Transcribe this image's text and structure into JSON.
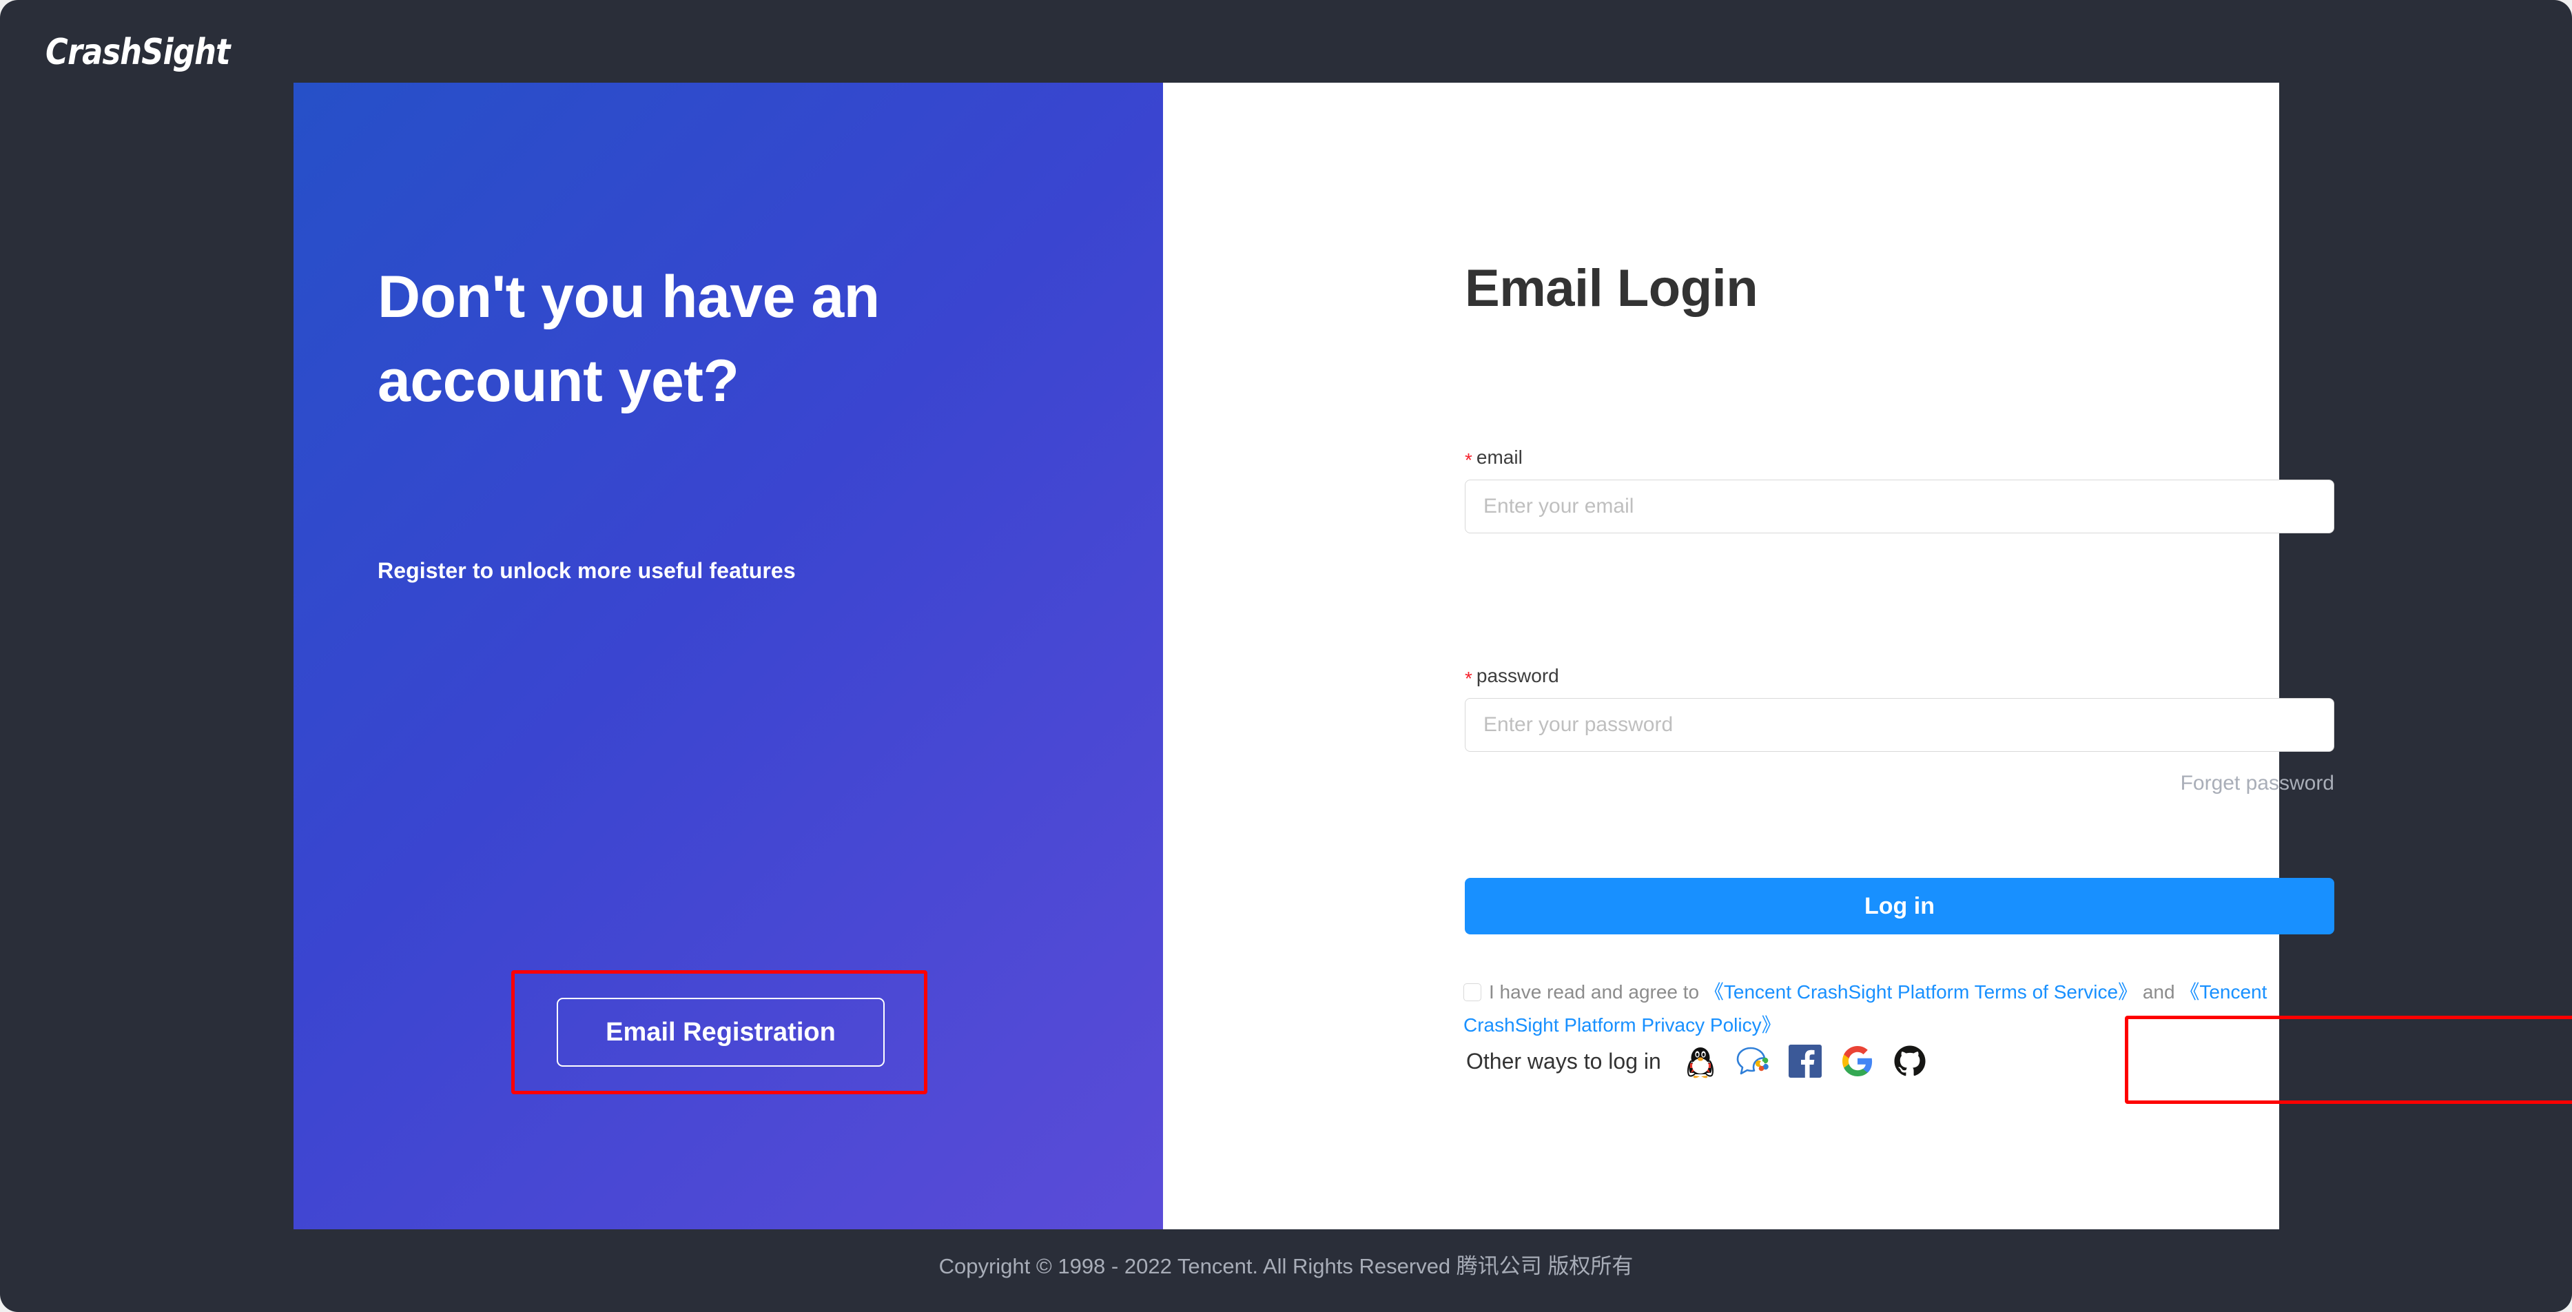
{
  "brand": {
    "name": "CrashSight"
  },
  "promo": {
    "headline": "Don't you have an account yet?",
    "subtitle": "Register to unlock more useful features",
    "register_button": "Email Registration"
  },
  "form": {
    "title": "Email Login",
    "required_mark": "*",
    "email": {
      "label": "email",
      "placeholder": "Enter your email",
      "value": ""
    },
    "password": {
      "label": "password",
      "placeholder": "Enter your password",
      "value": ""
    },
    "forget_password": "Forget password",
    "login_button": "Log in",
    "agreement": {
      "prefix": "I have read and agree to",
      "terms_link": "《Tencent CrashSight Platform Terms of Service》",
      "conjunction": "and",
      "privacy_link": "《Tencent CrashSight Platform Privacy Policy》",
      "checked": false
    },
    "social": {
      "label": "Other ways to log in",
      "options": [
        {
          "name": "qq-icon",
          "title": "QQ"
        },
        {
          "name": "wecom-icon",
          "title": "WeCom"
        },
        {
          "name": "facebook-icon",
          "title": "Facebook"
        },
        {
          "name": "google-icon",
          "title": "Google"
        },
        {
          "name": "github-icon",
          "title": "GitHub"
        }
      ]
    }
  },
  "footer": {
    "copyright": "Copyright © 1998 - 2022 Tencent. All Rights Reserved 腾讯公司 版权所有"
  },
  "colors": {
    "page_background": "#2a2e39",
    "promo_gradient_start": "#2650c8",
    "promo_gradient_end": "#5b4cd8",
    "primary_button": "#1890ff",
    "link": "#1890ff",
    "required_star": "#f5222d",
    "annotation_highlight": "#fe0000",
    "footer_text": "#a8adb8"
  },
  "annotations": [
    {
      "name": "register-button-highlight",
      "target": "Email Registration"
    },
    {
      "name": "social-login-highlight",
      "target": "Other ways to log in"
    }
  ]
}
